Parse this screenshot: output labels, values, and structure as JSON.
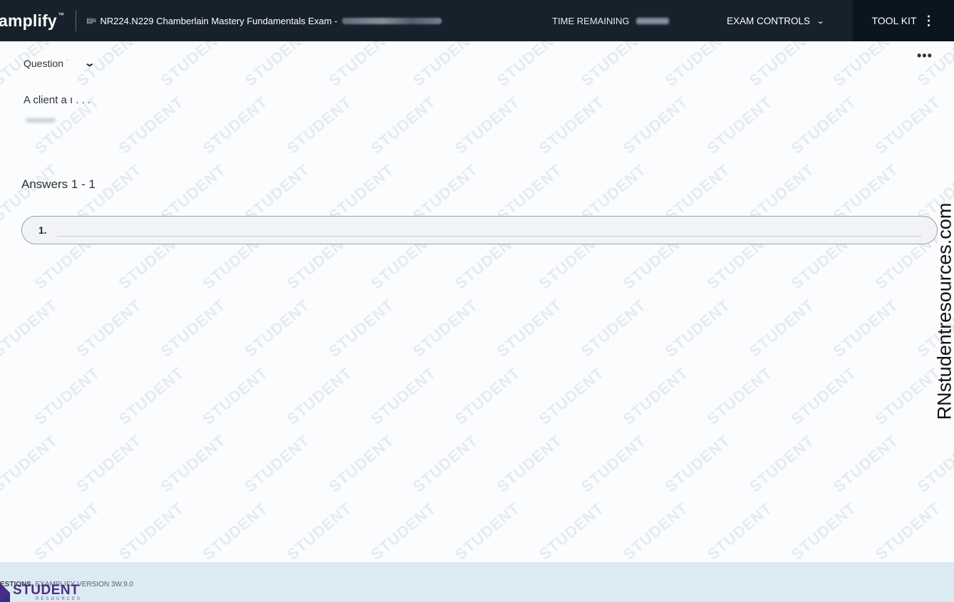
{
  "header": {
    "brand": "amplify",
    "brand_mark": "™",
    "exam_icon": "▤≡",
    "exam_title": "NR224.N229 Chamberlain Mastery Fundamentals Exam - ",
    "time_label": "TIME REMAINING",
    "exam_controls_label": "EXAM CONTROLS",
    "exam_controls_chevron": "⌄",
    "toolkit_label": "TOOL KIT",
    "toolkit_kebab": "⋮"
  },
  "question": {
    "selector_label": "Question",
    "selector_num": "ˉ",
    "selector_chevron": "⌄",
    "more_label": "•••",
    "stem_text": "A client a ı . . ."
  },
  "answers": {
    "title": "Answers 1 - 1",
    "items": [
      {
        "number": "1.",
        "text": ""
      }
    ]
  },
  "watermark_text": "STUDENT",
  "side_text": "RNstudentresources.com",
  "footer": {
    "questions_label": "ESTIONS",
    "version_label": "EXAMPLIFY VERSION 3W.9.0"
  },
  "logo": {
    "main": "STUDENT",
    "sub": "RESOURCES"
  }
}
